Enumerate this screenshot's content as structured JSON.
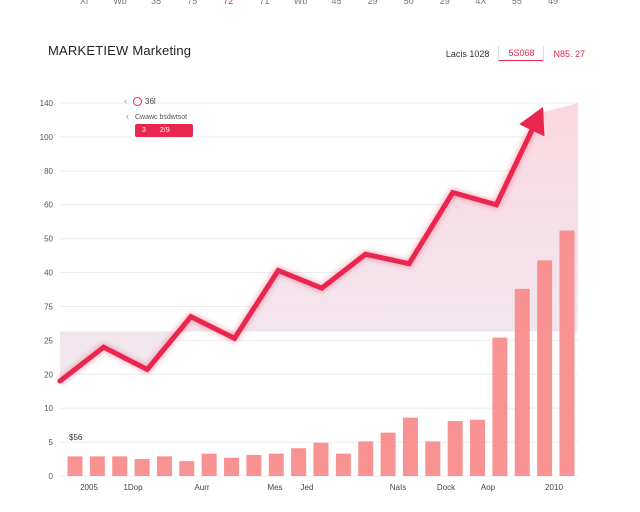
{
  "top_strip": {
    "labels": [
      "Xl",
      "Wb",
      "35",
      "75",
      "72",
      "71",
      "Wb",
      "45",
      "29",
      "50",
      "29",
      "4X",
      "55",
      "49"
    ],
    "active_index": 4
  },
  "header": {
    "title": "MARKETIEW Marketing",
    "stats": [
      {
        "label": "Lacis 1028",
        "tone": "default"
      },
      {
        "label": "5S068",
        "tone": "accent"
      },
      {
        "label": "N85. 27",
        "tone": "accent"
      }
    ]
  },
  "legend": {
    "toggle_label": "36l",
    "subtitle": "Cwawc bsdwtsot",
    "badge_left": "3",
    "badge_right": "2/9"
  },
  "corner_label": "$56",
  "colors": {
    "accent": "#e8264f",
    "bar": "#f98a8a",
    "area_top": "#fbdce3",
    "area_bottom": "#efe7ee"
  },
  "chart_data": {
    "type": "line",
    "title": "",
    "xlabel": "",
    "ylabel": "",
    "y_tick_labels": [
      "0",
      "5",
      "10",
      "20",
      "25",
      "75",
      "40",
      "50",
      "60",
      "80",
      "100",
      "140"
    ],
    "x_tick_labels": [
      "2005",
      "1Dop",
      "Aurr",
      "Mes",
      "Jed",
      "NaIs",
      "Dock",
      "Aop",
      "2010"
    ],
    "grid": true,
    "line": {
      "values": [
        14,
        19,
        15.7,
        23.5,
        20.3,
        30.3,
        27.7,
        32.7,
        31.3,
        41.8,
        40,
        53.5
      ]
    },
    "bars": {
      "values": [
        2.9,
        2.9,
        2.9,
        2.5,
        2.9,
        2.2,
        3.3,
        2.7,
        3.1,
        3.3,
        4.1,
        4.9,
        3.3,
        5.1,
        6.4,
        8.6,
        5.1,
        8.1,
        8.3,
        20.4,
        27.6,
        31.8,
        36.2
      ]
    }
  }
}
